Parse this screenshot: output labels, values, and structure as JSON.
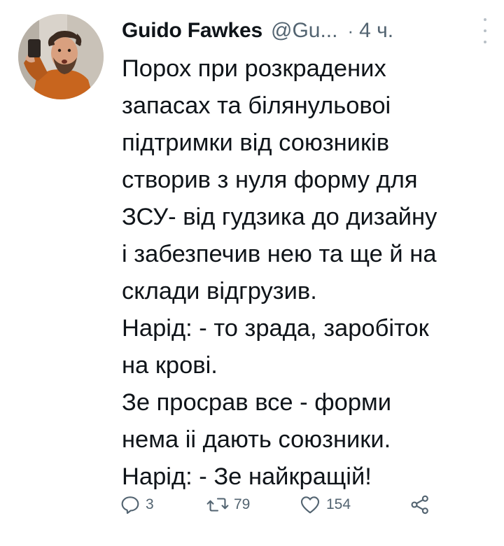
{
  "tweet": {
    "author": {
      "display_name": "Guido Fawkes",
      "handle": "@Gu...",
      "avatar": "profile-photo"
    },
    "separator": "·",
    "timestamp": "4 ч.",
    "more_icon": "more-vertical-icon",
    "body_lines": [
      "Порох при розкрадених",
      "запасах та білянульовоі",
      "підтримки від союзників",
      "створив з нуля форму для",
      "ЗСУ- від гудзика до дизайну",
      "і забезпечив нею та ще й на",
      "склади відгрузив.",
      "Нарід: - то зрада, заробіток",
      "на крові.",
      "Зе просрав все - форми",
      "нема іі дають союзники.",
      "Нарід: - Зе найкращій!"
    ],
    "actions": {
      "reply": {
        "icon": "reply-icon",
        "count": "3"
      },
      "retweet": {
        "icon": "retweet-icon",
        "count": "79"
      },
      "like": {
        "icon": "heart-icon",
        "count": "154"
      },
      "share": {
        "icon": "share-icon"
      }
    },
    "colors": {
      "text": "#0f1419",
      "secondary": "#536471",
      "background": "#ffffff"
    }
  }
}
